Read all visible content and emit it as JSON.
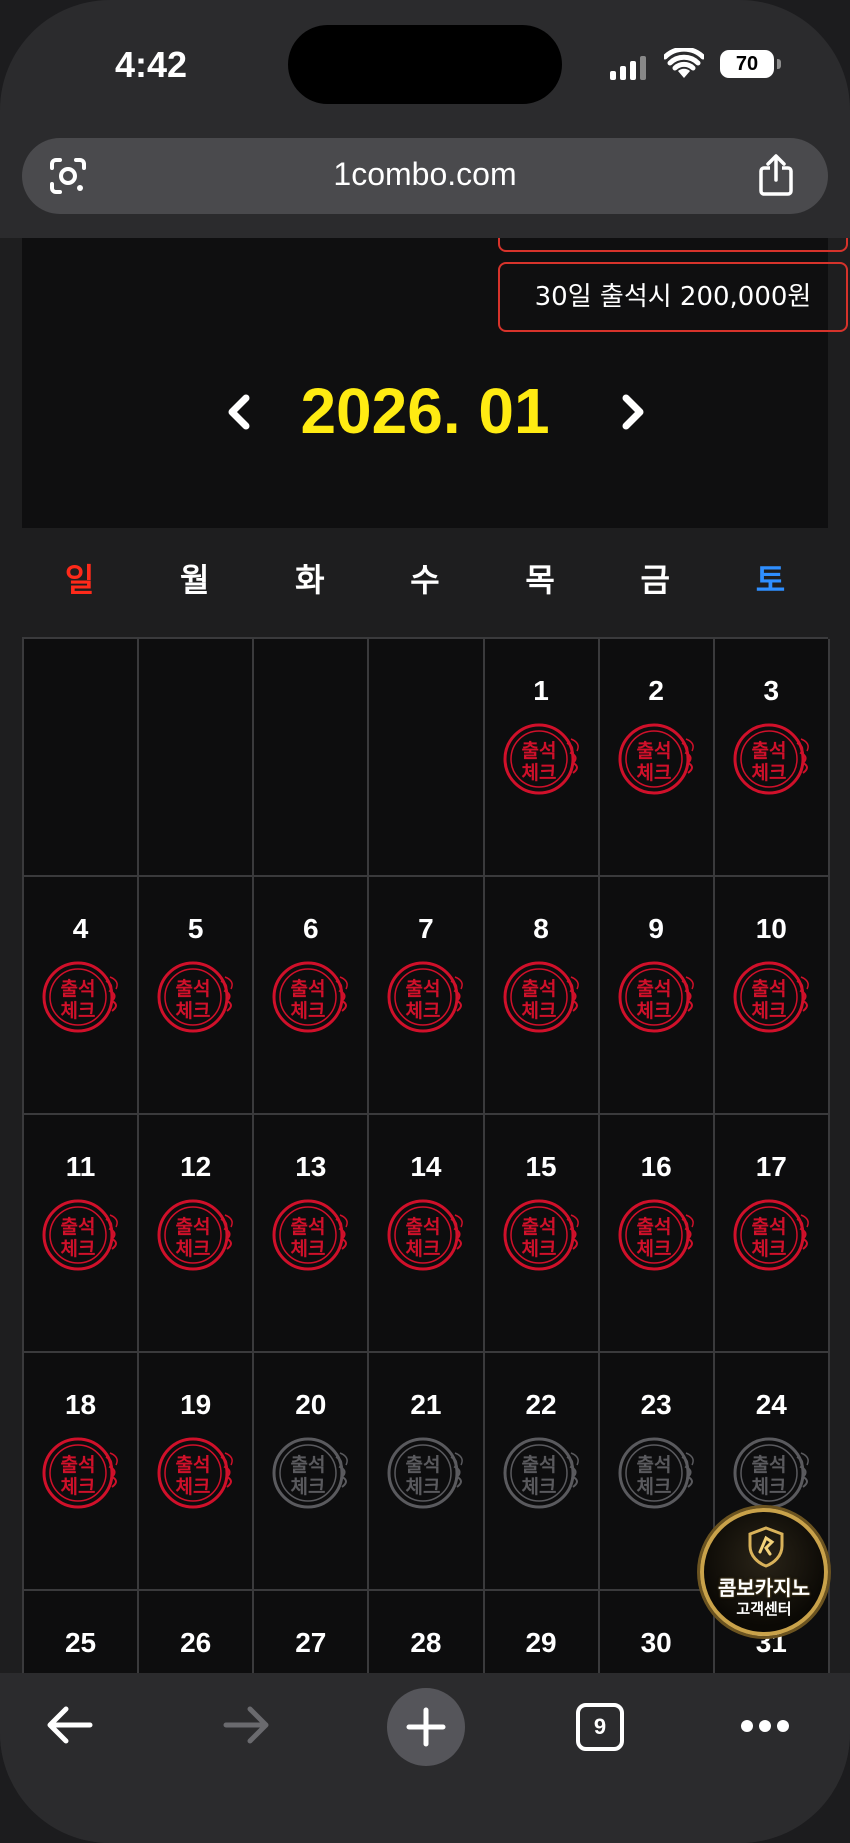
{
  "status_bar": {
    "time": "4:42",
    "battery": "70",
    "icons": [
      "signal-icon",
      "wifi-icon",
      "battery-icon"
    ]
  },
  "browser": {
    "url": "1combo.com",
    "tab_count": "9",
    "icons": [
      "lens-icon",
      "share-icon",
      "back-icon",
      "forward-icon",
      "new-tab-icon",
      "tabs-icon",
      "more-icon"
    ]
  },
  "page": {
    "reward_text": "30일 출석시 200,000원",
    "month": "2026. 01",
    "weekdays": [
      "일",
      "월",
      "화",
      "수",
      "목",
      "금",
      "토"
    ],
    "days": [
      {
        "day": "",
        "stamp": "none"
      },
      {
        "day": "",
        "stamp": "none"
      },
      {
        "day": "",
        "stamp": "none"
      },
      {
        "day": "",
        "stamp": "none"
      },
      {
        "day": "1",
        "stamp": "checked"
      },
      {
        "day": "2",
        "stamp": "checked"
      },
      {
        "day": "3",
        "stamp": "checked"
      },
      {
        "day": "4",
        "stamp": "checked"
      },
      {
        "day": "5",
        "stamp": "checked"
      },
      {
        "day": "6",
        "stamp": "checked"
      },
      {
        "day": "7",
        "stamp": "checked"
      },
      {
        "day": "8",
        "stamp": "checked"
      },
      {
        "day": "9",
        "stamp": "checked"
      },
      {
        "day": "10",
        "stamp": "checked"
      },
      {
        "day": "11",
        "stamp": "checked"
      },
      {
        "day": "12",
        "stamp": "checked"
      },
      {
        "day": "13",
        "stamp": "checked"
      },
      {
        "day": "14",
        "stamp": "checked"
      },
      {
        "day": "15",
        "stamp": "checked"
      },
      {
        "day": "16",
        "stamp": "checked"
      },
      {
        "day": "17",
        "stamp": "checked"
      },
      {
        "day": "18",
        "stamp": "checked"
      },
      {
        "day": "19",
        "stamp": "checked"
      },
      {
        "day": "20",
        "stamp": "unchecked"
      },
      {
        "day": "21",
        "stamp": "unchecked"
      },
      {
        "day": "22",
        "stamp": "unchecked"
      },
      {
        "day": "23",
        "stamp": "unchecked"
      },
      {
        "day": "24",
        "stamp": "unchecked"
      },
      {
        "day": "25",
        "stamp": "none"
      },
      {
        "day": "26",
        "stamp": "none"
      },
      {
        "day": "27",
        "stamp": "none"
      },
      {
        "day": "28",
        "stamp": "none"
      },
      {
        "day": "29",
        "stamp": "none"
      },
      {
        "day": "30",
        "stamp": "none"
      },
      {
        "day": "31",
        "stamp": "none"
      }
    ],
    "stamp_text_line1": "출석",
    "stamp_text_line2": "체크"
  },
  "support_badge": {
    "line1": "콤보카지노",
    "line2": "고객센터"
  },
  "colors": {
    "accent_yellow": "#ffeb12",
    "stamp_red": "#d0102a",
    "stamp_gray": "#5a5a5e",
    "sunday_red": "#ff2a1a",
    "saturday_blue": "#2f8fff",
    "border_red": "#d6332b"
  }
}
